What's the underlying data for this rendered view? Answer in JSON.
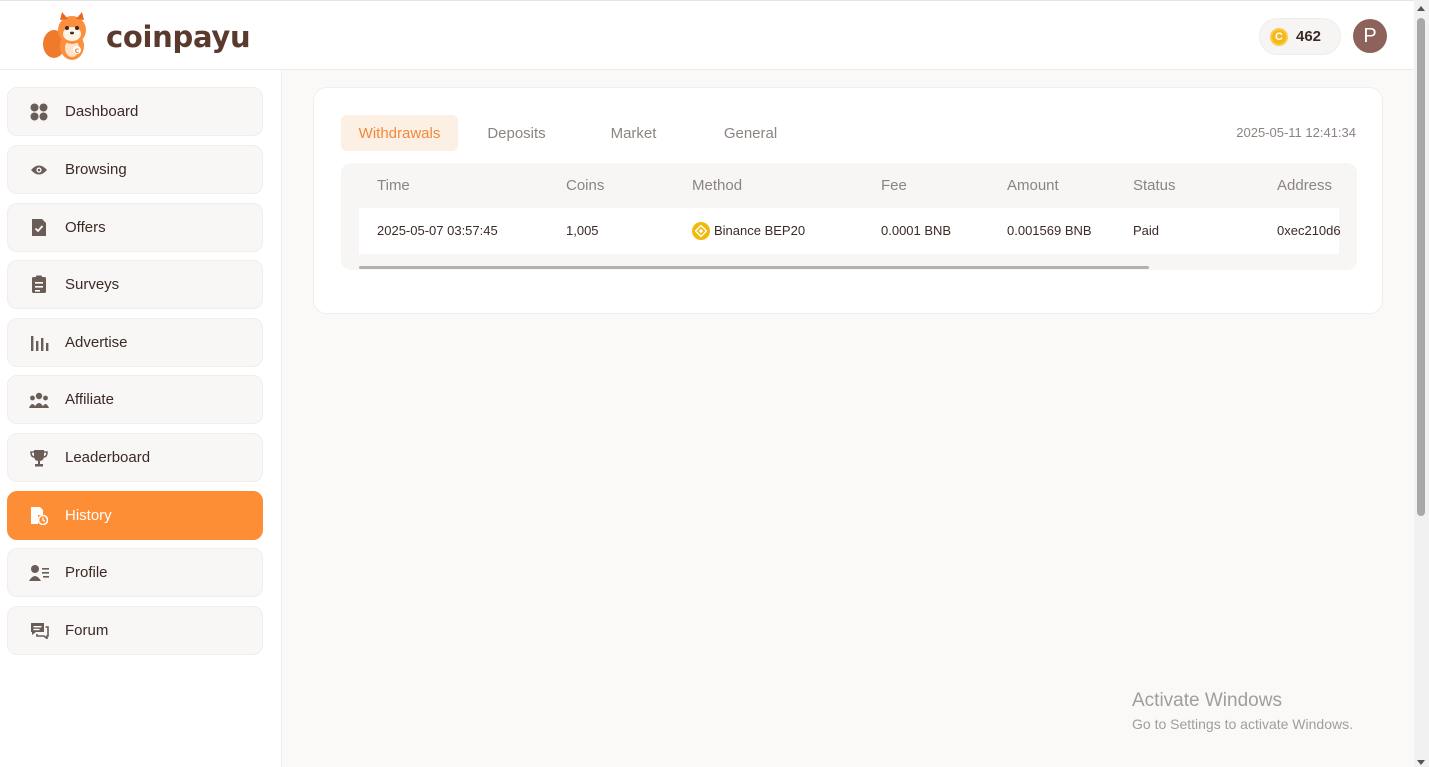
{
  "app": {
    "logo_text": "coinpayu"
  },
  "header": {
    "coin_balance": "462",
    "coin_symbol": "C",
    "avatar_initial": "P"
  },
  "sidebar": {
    "items": [
      {
        "label": "Dashboard",
        "icon": "dashboard-icon"
      },
      {
        "label": "Browsing",
        "icon": "eye-icon"
      },
      {
        "label": "Offers",
        "icon": "document-check-icon"
      },
      {
        "label": "Surveys",
        "icon": "checklist-icon"
      },
      {
        "label": "Advertise",
        "icon": "bar-chart-icon"
      },
      {
        "label": "Affiliate",
        "icon": "users-icon"
      },
      {
        "label": "Leaderboard",
        "icon": "trophy-icon"
      },
      {
        "label": "History",
        "icon": "history-icon",
        "active": true
      },
      {
        "label": "Profile",
        "icon": "profile-icon"
      },
      {
        "label": "Forum",
        "icon": "chat-icon"
      }
    ]
  },
  "history": {
    "tabs": [
      {
        "label": "Withdrawals",
        "active": true
      },
      {
        "label": "Deposits"
      },
      {
        "label": "Market"
      },
      {
        "label": "General"
      }
    ],
    "timestamp": "2025-05-11 12:41:34",
    "columns": [
      "Time",
      "Coins",
      "Method",
      "Fee",
      "Amount",
      "Status",
      "Address"
    ],
    "rows": [
      {
        "time": "2025-05-07 03:57:45",
        "coins": "1,005",
        "method": "Binance BEP20",
        "method_icon": "binance-icon",
        "fee": "0.0001 BNB",
        "amount": "0.001569 BNB",
        "status": "Paid",
        "address": "0xec210d6"
      }
    ]
  },
  "watermark": {
    "title": "Activate Windows",
    "subtitle": "Go to Settings to activate Windows."
  },
  "colors": {
    "accent": "#fd8e36",
    "coin": "#f5b81c",
    "binance": "#f0b90b",
    "avatar": "#8c625a"
  }
}
